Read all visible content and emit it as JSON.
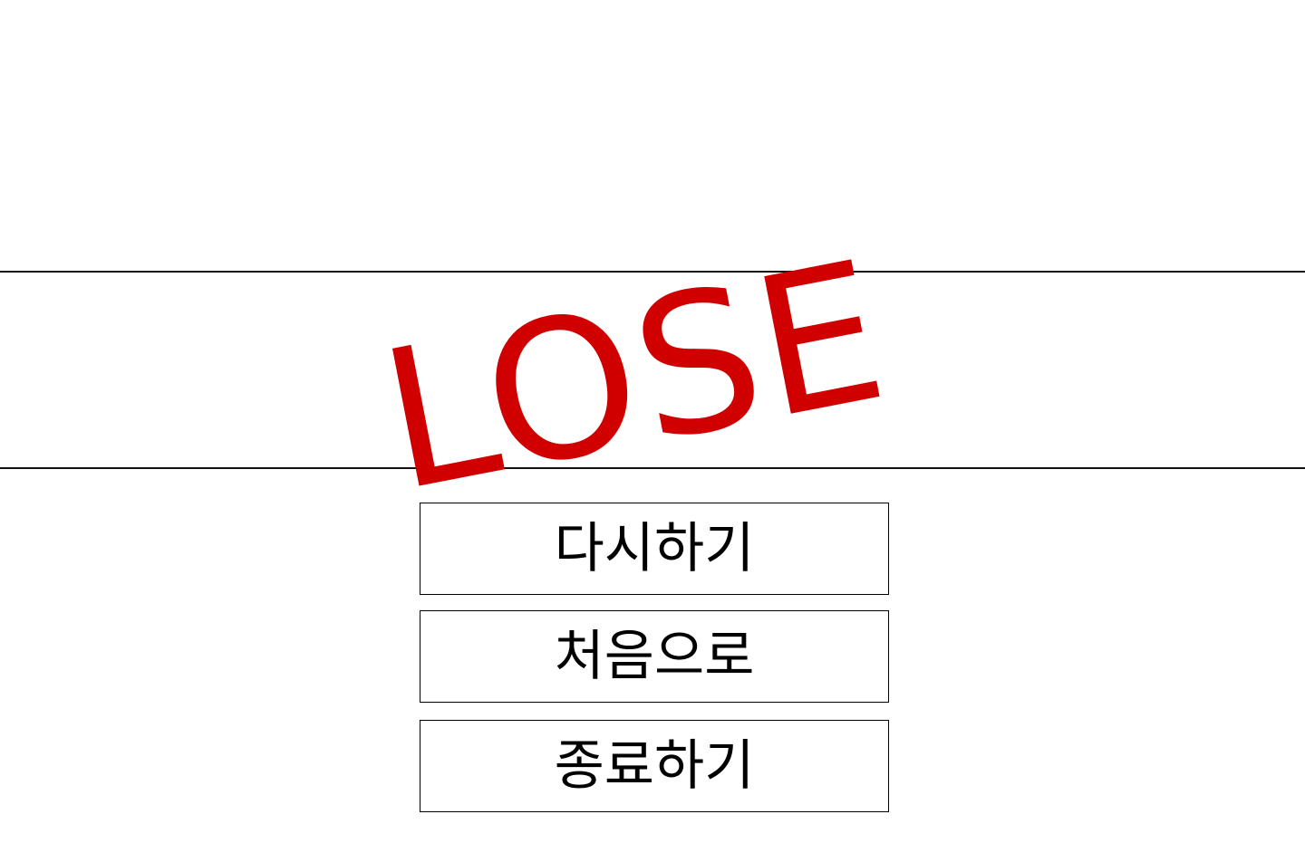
{
  "result": {
    "label": "LOSE",
    "color": "#d10000"
  },
  "menu": {
    "items": [
      {
        "label": "다시하기"
      },
      {
        "label": "처음으로"
      },
      {
        "label": "종료하기"
      }
    ]
  }
}
